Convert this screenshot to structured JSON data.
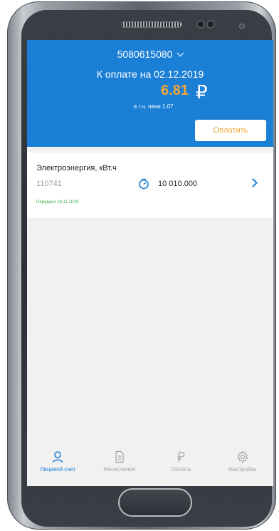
{
  "header": {
    "account_number": "5080615080",
    "due_label": "К оплате на 02.12.2019",
    "amount": "6.81",
    "currency_symbol": "₽",
    "penalty_note": "в т.ч. пени 1.07",
    "pay_button": "Оплатить"
  },
  "meter_card": {
    "service_name": "Электроэнергия, кВт.ч",
    "meter_number": "110741",
    "reading": "10 010.000",
    "status": "Передано 18.11.2019"
  },
  "tabbar": {
    "items": [
      {
        "label": "Лицевой счет",
        "icon": "person-icon",
        "active": true
      },
      {
        "label": "Начисления",
        "icon": "document-icon",
        "active": false
      },
      {
        "label": "Оплата",
        "icon": "ruble-icon",
        "active": false
      },
      {
        "label": "Настройки",
        "icon": "gear-icon",
        "active": false
      }
    ]
  },
  "colors": {
    "primary": "#1a7fd5",
    "accent": "#f5a637",
    "success": "#3bb04a",
    "muted": "#9ea3a8"
  }
}
